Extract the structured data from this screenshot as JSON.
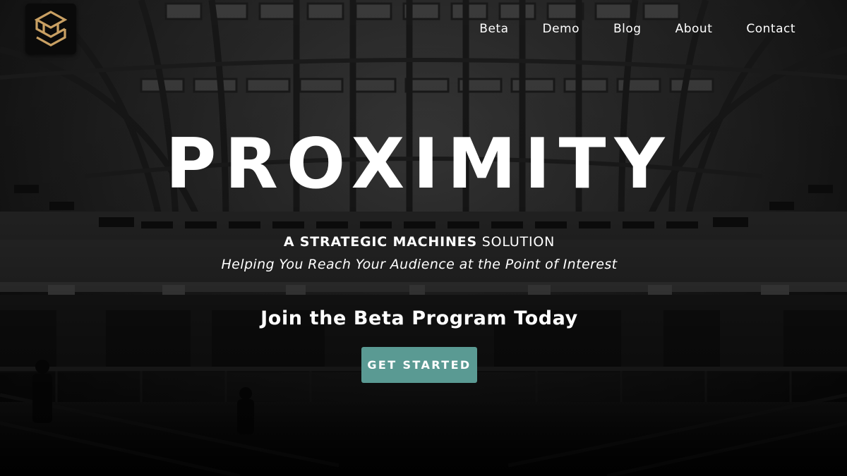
{
  "brand": {
    "logo_icon": "sm-monogram-logo-icon",
    "logo_color": "#c9a063"
  },
  "nav": {
    "items": [
      {
        "label": "Beta"
      },
      {
        "label": "Demo"
      },
      {
        "label": "Blog"
      },
      {
        "label": "About"
      },
      {
        "label": "Contact"
      }
    ]
  },
  "hero": {
    "title": "PROXIMITY",
    "tagline_bold": "A STRATEGIC MACHINES",
    "tagline_rest": "SOLUTION",
    "subtagline": "Helping You Reach Your Audience at the Point of Interest",
    "join_text": "Join the Beta Program Today",
    "cta_label": "GET STARTED",
    "cta_color": "#5a9a93"
  }
}
